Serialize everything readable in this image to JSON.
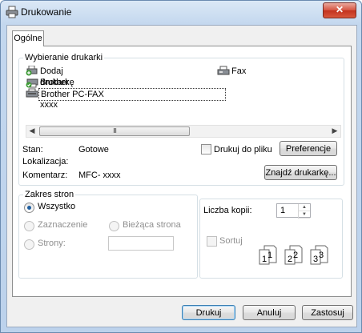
{
  "window": {
    "title": "Drukowanie",
    "close_label": "✕"
  },
  "tabs": [
    {
      "label": "Ogólne",
      "selected": true
    }
  ],
  "printer_group": {
    "legend": "Wybieranie drukarki",
    "printers": [
      {
        "label": "Dodaj drukarkę",
        "icon": "add-printer-icon"
      },
      {
        "label": "Fax",
        "icon": "fax-printer-icon"
      },
      {
        "label": "Brother MFC-xxxx",
        "icon": "default-printer-icon"
      },
      {
        "label": "Brother PC-FAX",
        "icon": "printer-icon",
        "selected": true
      }
    ],
    "scrollbar_grip": "III",
    "status_label": "Stan:",
    "status_value": "Gotowe",
    "location_label": "Lokalizacja:",
    "location_value": "",
    "comment_label": "Komentarz:",
    "comment_value": "MFC- xxxx",
    "print_to_file_label": "Drukuj do pliku",
    "preferences_button": "Preferencje",
    "find_printer_button": "Znajdź drukarkę..."
  },
  "page_range_group": {
    "legend": "Zakres stron",
    "all_label": "Wszystko",
    "selection_label": "Zaznaczenie",
    "current_page_label": "Bieżąca strona",
    "pages_label": "Strony:",
    "pages_value": ""
  },
  "copies_group": {
    "copies_label": "Liczba kopii:",
    "copies_value": "1",
    "collate_label": "Sortuj",
    "collate_pages": [
      "1",
      "1",
      "2",
      "2",
      "3",
      "3"
    ]
  },
  "buttons": {
    "print": "Drukuj",
    "cancel": "Anuluj",
    "apply": "Zastosuj"
  },
  "colors": {
    "titlebar": "#c3d7ee",
    "close": "#c2321f",
    "accent": "#3c7fb1"
  }
}
